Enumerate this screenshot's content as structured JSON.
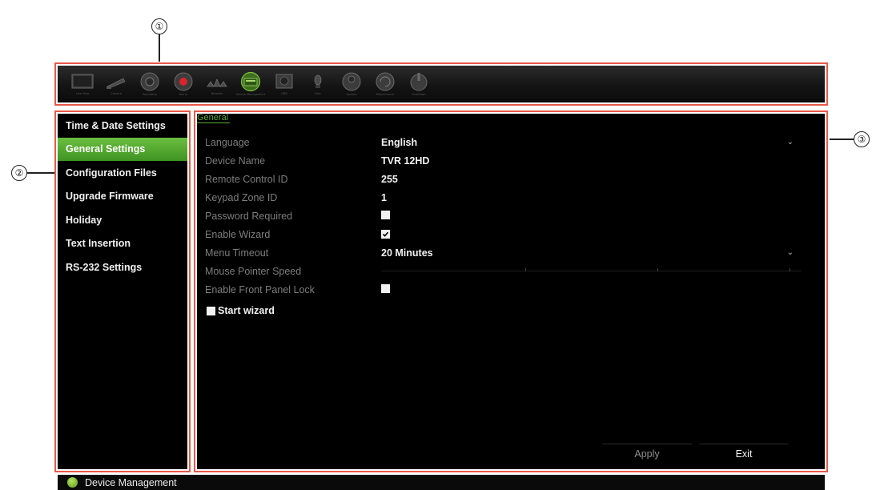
{
  "callouts": [
    "①",
    "②",
    "③"
  ],
  "toolbar": {
    "items": [
      {
        "icon": "live-view-icon",
        "caption": "Live View"
      },
      {
        "icon": "camera-icon",
        "caption": "Camera"
      },
      {
        "icon": "recording-icon",
        "caption": "Recording"
      },
      {
        "icon": "alarm-icon",
        "caption": "Alarm"
      },
      {
        "icon": "network-icon",
        "caption": "Network"
      },
      {
        "icon": "device-management-icon",
        "caption": "Device Management"
      },
      {
        "icon": "hdd-icon",
        "caption": "HDD"
      },
      {
        "icon": "user-icon",
        "caption": "User"
      },
      {
        "icon": "system-info-icon",
        "caption": "System"
      },
      {
        "icon": "maintenance-icon",
        "caption": "Maintenance"
      },
      {
        "icon": "shutdown-icon",
        "caption": "Shutdown"
      }
    ],
    "active_index": 5
  },
  "sidebar": {
    "items": [
      {
        "label": "Time & Date Settings",
        "active": false
      },
      {
        "label": "General Settings",
        "active": true
      },
      {
        "label": "Configuration Files",
        "active": false
      },
      {
        "label": "Upgrade Firmware",
        "active": false
      },
      {
        "label": "Holiday",
        "active": false
      },
      {
        "label": "Text Insertion",
        "active": false
      },
      {
        "label": "RS-232 Settings",
        "active": false
      }
    ]
  },
  "panel": {
    "tab": "General",
    "fields": {
      "language": {
        "label": "Language",
        "value": "English"
      },
      "device_name": {
        "label": "Device Name",
        "value": "TVR 12HD"
      },
      "remote_control_id": {
        "label": "Remote Control ID",
        "value": "255"
      },
      "keypad_zone_id": {
        "label": "Keypad Zone ID",
        "value": "1"
      },
      "password_required": {
        "label": "Password Required",
        "checked": false
      },
      "enable_wizard": {
        "label": "Enable Wizard",
        "checked": true
      },
      "menu_timeout": {
        "label": "Menu Timeout",
        "value": "20 Minutes"
      },
      "mouse_pointer_speed": {
        "label": "Mouse Pointer Speed"
      },
      "enable_front_panel_lock": {
        "label": "Enable Front Panel Lock",
        "checked": false
      }
    },
    "start_wizard": {
      "label": "Start wizard",
      "checked": false
    },
    "apply_label": "Apply",
    "exit_label": "Exit"
  },
  "statusbar": {
    "text": "Device Management"
  },
  "colors": {
    "accent": "#5aa832",
    "highlight_box": "#e8594a",
    "panel_bg": "#000000"
  }
}
